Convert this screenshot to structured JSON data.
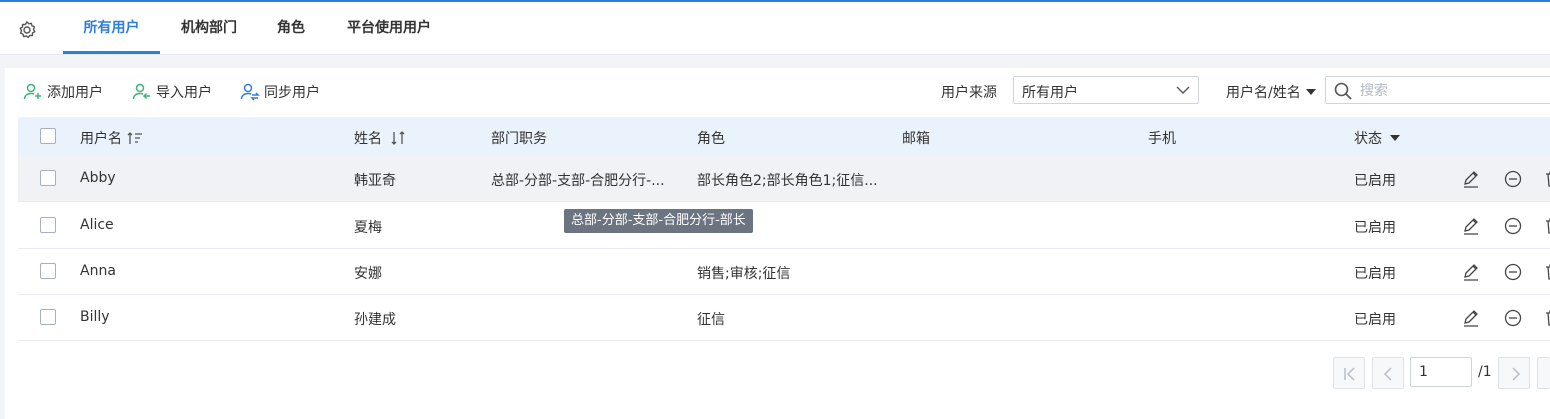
{
  "tabs": [
    {
      "label": "所有用户",
      "active": true
    },
    {
      "label": "机构部门",
      "active": false
    },
    {
      "label": "角色",
      "active": false
    },
    {
      "label": "平台使用用户",
      "active": false
    }
  ],
  "toolbar": {
    "add_label": "添加用户",
    "import_label": "导入用户",
    "sync_label": "同步用户"
  },
  "filters": {
    "source_label": "用户来源",
    "source_value": "所有用户",
    "search_field_label": "用户名/姓名",
    "search_placeholder": "搜索"
  },
  "table": {
    "headers": {
      "username": "用户名",
      "name": "姓名",
      "dept": "部门职务",
      "role": "角色",
      "email": "邮箱",
      "phone": "手机",
      "status": "状态"
    },
    "rows": [
      {
        "username": "Abby",
        "name": "韩亚奇",
        "dept": "总部-分部-支部-合肥分行-...",
        "role": "部长角色2;部长角色1;征信...",
        "email": "",
        "phone": "",
        "status": "已启用"
      },
      {
        "username": "Alice",
        "name": "夏梅",
        "dept": "",
        "role": "",
        "email": "",
        "phone": "",
        "status": "已启用"
      },
      {
        "username": "Anna",
        "name": "安娜",
        "dept": "",
        "role": "销售;审核;征信",
        "email": "",
        "phone": "",
        "status": "已启用"
      },
      {
        "username": "Billy",
        "name": "孙建成",
        "dept": "",
        "role": "征信",
        "email": "",
        "phone": "",
        "status": "已启用"
      }
    ]
  },
  "tooltip": "总部-分部-支部-合肥分行-部长",
  "pagination": {
    "current": "1",
    "total": "/1"
  },
  "colors": {
    "accent": "#2f7fd8",
    "add_icon": "#3db37a",
    "sync_icon": "#2f7fd8"
  }
}
